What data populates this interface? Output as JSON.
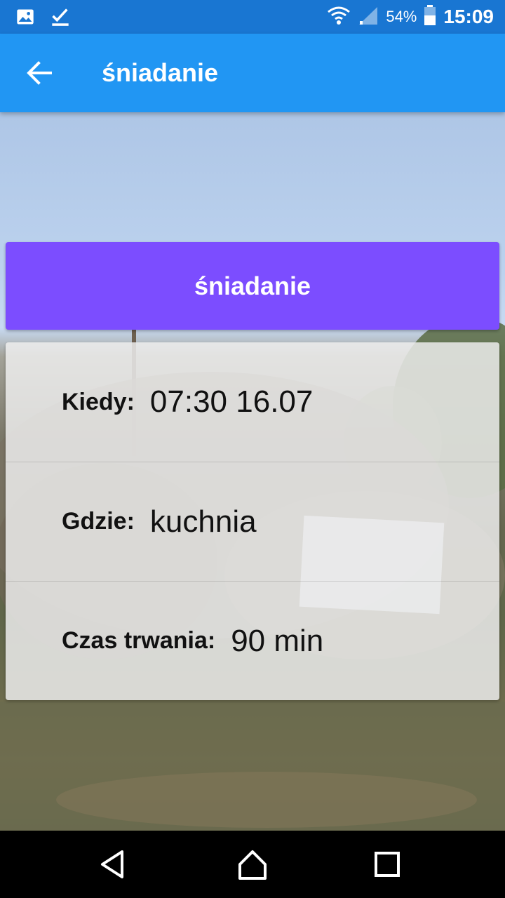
{
  "status_bar": {
    "icons_left": [
      "image-icon",
      "checkmark-icon"
    ],
    "icons_right": [
      "wifi-icon",
      "signal-icon",
      "battery-icon"
    ],
    "battery": "54%",
    "time": "15:09"
  },
  "app_bar": {
    "title": "śniadanie",
    "back_icon": "arrow-left-icon"
  },
  "event": {
    "header_label": "śniadanie",
    "details": [
      {
        "label": "Kiedy:",
        "value": "07:30 16.07"
      },
      {
        "label": "Gdzie:",
        "value": "kuchnia"
      },
      {
        "label": "Czas trwania:",
        "value": "90 min"
      }
    ]
  },
  "nav_bar": {
    "buttons": [
      "back-triangle-icon",
      "home-circle-icon",
      "recents-square-icon"
    ]
  },
  "colors": {
    "status_bar": "#1976d2",
    "app_bar": "#2196f3",
    "event_header": "#7c4dff",
    "card_background": "#eeeeee"
  }
}
